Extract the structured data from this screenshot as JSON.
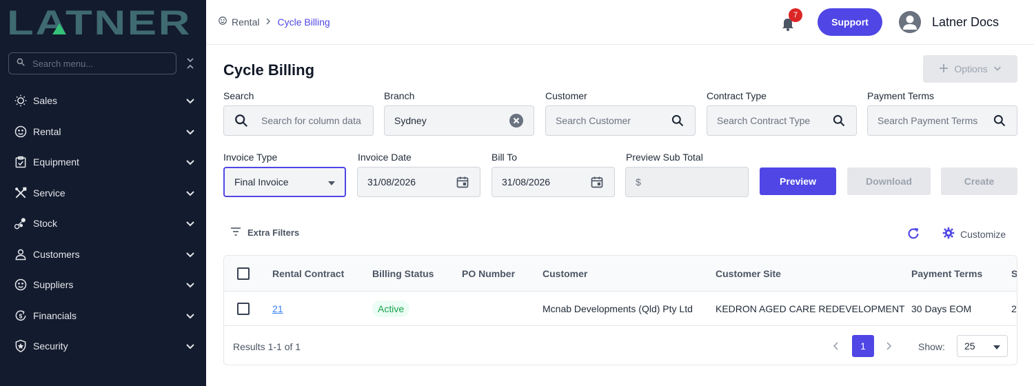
{
  "brand": {
    "logo_text": "LATNER"
  },
  "sidebar": {
    "search_placeholder": "Search menu...",
    "items": [
      {
        "label": "Sales",
        "icon": "sales-icon"
      },
      {
        "label": "Rental",
        "icon": "rental-icon"
      },
      {
        "label": "Equipment",
        "icon": "equipment-icon"
      },
      {
        "label": "Service",
        "icon": "service-icon"
      },
      {
        "label": "Stock",
        "icon": "stock-icon"
      },
      {
        "label": "Customers",
        "icon": "customers-icon"
      },
      {
        "label": "Suppliers",
        "icon": "suppliers-icon"
      },
      {
        "label": "Financials",
        "icon": "financials-icon"
      },
      {
        "label": "Security",
        "icon": "security-icon"
      }
    ]
  },
  "topbar": {
    "breadcrumb": {
      "home": "Rental",
      "current": "Cycle Billing"
    },
    "notifications_count": "7",
    "support_label": "Support",
    "user_name": "Latner Docs"
  },
  "page": {
    "title": "Cycle Billing",
    "options_label": "Options"
  },
  "filters": {
    "search": {
      "label": "Search",
      "placeholder": "Search for column data"
    },
    "branch": {
      "label": "Branch",
      "value": "Sydney"
    },
    "customer": {
      "label": "Customer",
      "placeholder": "Search Customer"
    },
    "contract_type": {
      "label": "Contract Type",
      "placeholder": "Search Contract Type"
    },
    "payment_terms": {
      "label": "Payment Terms",
      "placeholder": "Search Payment Terms"
    },
    "invoice_type": {
      "label": "Invoice Type",
      "value": "Final Invoice"
    },
    "invoice_date": {
      "label": "Invoice Date",
      "value": "31/08/2026"
    },
    "bill_to": {
      "label": "Bill To",
      "value": "31/08/2026"
    },
    "preview_sub_total": {
      "label": "Preview Sub Total",
      "prefix": "$",
      "value": ""
    }
  },
  "actions": {
    "preview": "Preview",
    "download": "Download",
    "create": "Create"
  },
  "toolbar": {
    "extra_filters": "Extra Filters",
    "customize": "Customize"
  },
  "table": {
    "columns": [
      "Rental Contract",
      "Billing Status",
      "PO Number",
      "Customer",
      "Customer Site",
      "Payment Terms",
      "S"
    ],
    "rows": [
      {
        "rental_contract": "21",
        "billing_status": "Active",
        "po_number": "",
        "customer": "Mcnab Developments (Qld) Pty Ltd",
        "customer_site": "KEDRON AGED CARE REDEVELOPMENT",
        "payment_terms": "30 Days EOM",
        "extra": "2"
      }
    ],
    "results_text": "Results 1-1 of 1",
    "current_page": "1",
    "show_label": "Show:",
    "page_size": "25"
  },
  "colors": {
    "accent": "#4f46e5",
    "sidebar_bg": "#131b2e",
    "logo_teal": "#3f6a72",
    "logo_accent": "#34c27a",
    "status_green": "#16a34a",
    "badge_red": "#dc2626"
  }
}
